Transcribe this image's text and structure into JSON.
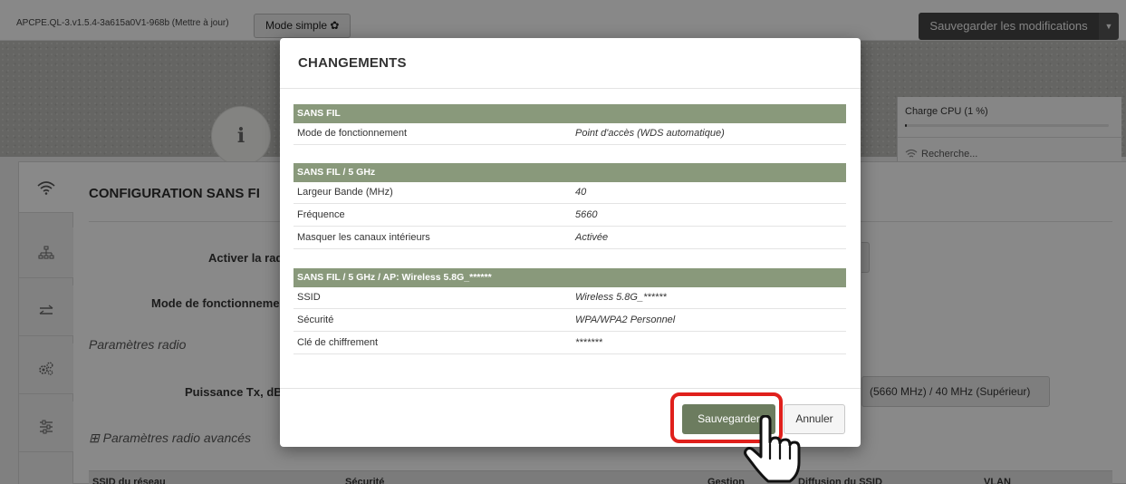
{
  "topbar": {
    "version": "APCPE.QL-3.v1.5.4-3a615a0V1-968b (Mettre à jour)",
    "mode_button": "Mode simple ✿",
    "save_all": "Sauvegarder les modifications",
    "save_caret": "▼"
  },
  "banner": {
    "info_glyph": "i",
    "cpu_label": "Charge CPU (1 %)",
    "cpu_percent": 1,
    "search_text": "Recherche..."
  },
  "page": {
    "config_title": "CONFIGURATION SANS FI",
    "activate_radio_label": "Activer la rad",
    "mode_label": "Mode de fonctionneme",
    "radio_params": "Paramètres radio",
    "tx_power_label": "Puissance Tx, dB",
    "frequency_value": "(5660 MHz) / 40 MHz (Supérieur)",
    "advanced_params": "⊞ Paramètres radio avancés",
    "table_headers": [
      "SSID du réseau",
      "Sécurité",
      "Gestion",
      "Diffusion du SSID",
      "VLAN"
    ]
  },
  "modal": {
    "title": "CHANGEMENTS",
    "sections": [
      {
        "header": "SANS FIL",
        "rows": [
          {
            "key": "Mode de fonctionnement",
            "value": "Point d'accès (WDS automatique)"
          }
        ]
      },
      {
        "header": "SANS FIL / 5 GHz",
        "rows": [
          {
            "key": "Largeur Bande (MHz)",
            "value": "40"
          },
          {
            "key": "Fréquence",
            "value": "5660"
          },
          {
            "key": "Masquer les canaux intérieurs",
            "value": "Activée"
          }
        ]
      },
      {
        "header": "SANS FIL / 5 GHz / AP: Wireless 5.8G_******",
        "rows": [
          {
            "key": "SSID",
            "value": "Wireless 5.8G_******"
          },
          {
            "key": "Sécurité",
            "value": "WPA/WPA2 Personnel"
          },
          {
            "key": "Clé de chiffrement",
            "value": "*******"
          }
        ]
      }
    ],
    "save_button": "Sauvegarder",
    "cancel_button": "Annuler"
  },
  "colors": {
    "section_header": "#89997b",
    "save_button": "#6c7c5f",
    "highlight": "#e0201c"
  },
  "icons": [
    "wifi-icon",
    "network-icon",
    "transfer-icon",
    "gears-icon",
    "sliders-icon",
    "hand-pointer-icon"
  ]
}
